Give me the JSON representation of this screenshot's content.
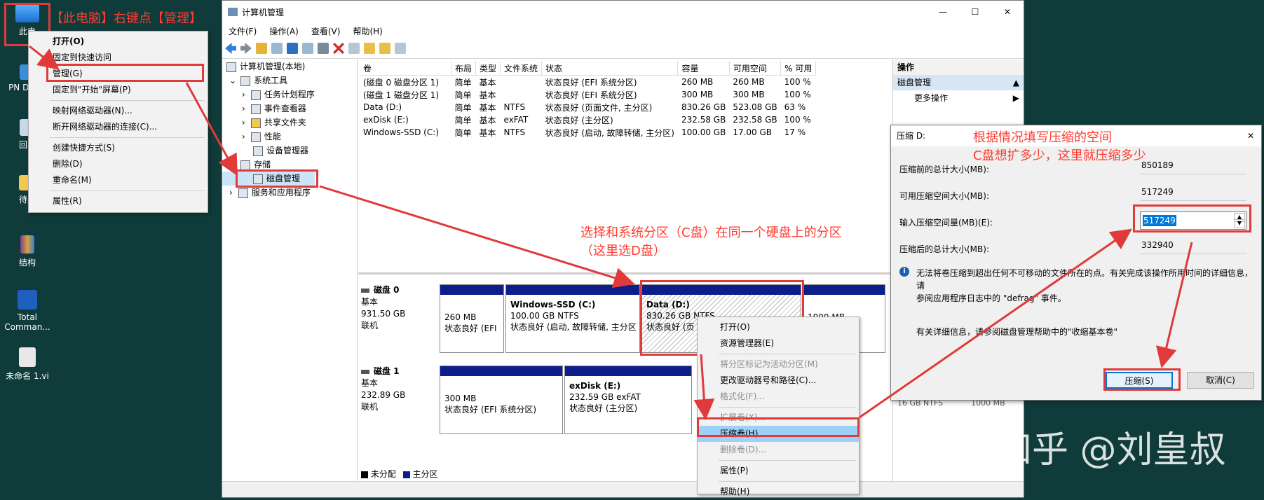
{
  "annotations": {
    "step1": "【此电脑】右键点【管理】",
    "select_partition_1": "选择和系统分区（C盘）在同一个硬盘上的分区",
    "select_partition_2": "（这里选D盘）",
    "shrink_space_1": "根据情况填写压缩的空间",
    "shrink_space_2": "C盘想扩多少，这里就压缩多少",
    "watermark": "知乎 @刘皇叔"
  },
  "desktop_icons": [
    "此电",
    "PN Desig",
    "回收",
    "待办",
    "结构",
    "Total Comman...",
    "未命名 1.vi"
  ],
  "this_pc_menu": [
    "打开(O)",
    "固定到快速访问",
    "管理(G)",
    "固定到\"开始\"屏幕(P)",
    "映射网络驱动器(N)...",
    "断开网络驱动器的连接(C)...",
    "创建快捷方式(S)",
    "删除(D)",
    "重命名(M)",
    "属性(R)"
  ],
  "window": {
    "title": "计算机管理",
    "menu": [
      "文件(F)",
      "操作(A)",
      "查看(V)",
      "帮助(H)"
    ],
    "controls": {
      "min": "—",
      "max": "☐",
      "close": "✕"
    }
  },
  "tree": [
    "计算机管理(本地)",
    "系统工具",
    "任务计划程序",
    "事件查看器",
    "共享文件夹",
    "性能",
    "设备管理器",
    "存储",
    "磁盘管理",
    "服务和应用程序"
  ],
  "volume_table": {
    "headers": [
      "卷",
      "布局",
      "类型",
      "文件系统",
      "状态",
      "容量",
      "可用空间",
      "% 可用"
    ],
    "rows": [
      [
        "(磁盘 0 磁盘分区 1)",
        "简单",
        "基本",
        "",
        "状态良好 (EFI 系统分区)",
        "260 MB",
        "260 MB",
        "100 %"
      ],
      [
        "(磁盘 1 磁盘分区 1)",
        "简单",
        "基本",
        "",
        "状态良好 (EFI 系统分区)",
        "300 MB",
        "300 MB",
        "100 %"
      ],
      [
        "Data (D:)",
        "简单",
        "基本",
        "NTFS",
        "状态良好 (页面文件, 主分区)",
        "830.26 GB",
        "523.08 GB",
        "63 %"
      ],
      [
        "exDisk (E:)",
        "简单",
        "基本",
        "exFAT",
        "状态良好 (主分区)",
        "232.58 GB",
        "232.58 GB",
        "100 %"
      ],
      [
        "Windows-SSD (C:)",
        "简单",
        "基本",
        "NTFS",
        "状态良好 (启动, 故障转储, 主分区)",
        "100.00 GB",
        "17.00 GB",
        "17 %"
      ]
    ]
  },
  "disks": [
    {
      "name": "磁盘 0",
      "type": "基本",
      "size": "931.50 GB",
      "status": "联机",
      "parts": [
        {
          "title": "",
          "line1": "260 MB",
          "line2": "状态良好 (EFI"
        },
        {
          "title": "Windows-SSD  (C:)",
          "line1": "100.00 GB NTFS",
          "line2": "状态良好 (启动, 故障转储, 主分区"
        },
        {
          "title": "Data  (D:)",
          "line1": "830.26 GB NTFS",
          "line2": "状态良好 (页"
        },
        {
          "title": "",
          "line1": "1000 MB",
          "line2": ""
        }
      ]
    },
    {
      "name": "磁盘 1",
      "type": "基本",
      "size": "232.89 GB",
      "status": "联机",
      "parts": [
        {
          "title": "",
          "line1": "300 MB",
          "line2": "状态良好 (EFI 系统分区)"
        },
        {
          "title": "exDisk  (E:)",
          "line1": "232.59 GB exFAT",
          "line2": "状态良好 (主分区)"
        }
      ]
    }
  ],
  "legend": {
    "unallocated": "未分配",
    "primary": "主分区"
  },
  "disk_context_menu": [
    "打开(O)",
    "资源管理器(E)",
    "将分区标记为活动分区(M)",
    "更改驱动器号和路径(C)...",
    "格式化(F)...",
    "扩展卷(X)...",
    "压缩卷(H)...",
    "删除卷(D)...",
    "属性(P)",
    "帮助(H)"
  ],
  "actions": {
    "title": "操作",
    "section": "磁盘管理",
    "more": "更多操作",
    "peek1": "16 GB NTFS",
    "peek2": "1000 MB"
  },
  "dialog": {
    "title": "压缩 D:",
    "total_before_label": "压缩前的总计大小(MB):",
    "total_before": "850189",
    "available_label": "可用压缩空间大小(MB):",
    "available": "517249",
    "input_label": "输入压缩空间量(MB)(E):",
    "input_value": "517249",
    "total_after_label": "压缩后的总计大小(MB):",
    "total_after": "332940",
    "info_1": "无法将卷压缩到超出任何不可移动的文件所在的点。有关完成该操作所用时间的详细信息，请",
    "info_2": "参阅应用程序日志中的 \"defrag\" 事件。",
    "more_info": "有关详细信息，请参阅磁盘管理帮助中的\"收缩基本卷\"",
    "shrink_btn": "压缩(S)",
    "cancel_btn": "取消(C)"
  }
}
